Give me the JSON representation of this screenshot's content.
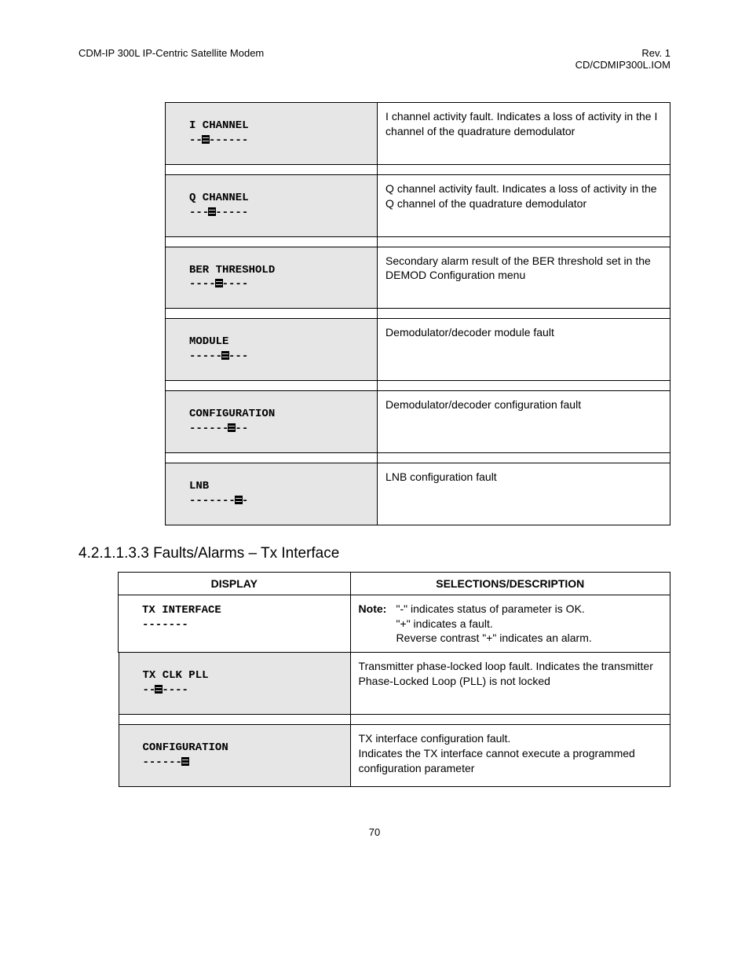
{
  "header": {
    "left": "CDM-IP 300L IP-Centric Satellite Modem",
    "right1": "Rev. 1",
    "right2": "CD/CDMIP300L.IOM"
  },
  "table1": {
    "rows": [
      {
        "label": "I CHANNEL",
        "pre": "--",
        "post": "------",
        "desc": "I channel activity fault. Indicates a loss of activity in the I channel of the quadrature demodulator"
      },
      {
        "label": "Q CHANNEL",
        "pre": "---",
        "post": "-----",
        "desc": "Q channel activity fault. Indicates a loss of activity in the Q channel of the quadrature demodulator"
      },
      {
        "label": "BER THRESHOLD",
        "pre": "----",
        "post": "----",
        "desc": "Secondary alarm result of the BER threshold set in the DEMOD Configuration menu"
      },
      {
        "label": "MODULE",
        "pre": "-----",
        "post": "---",
        "desc": "Demodulator/decoder module fault"
      },
      {
        "label": "CONFIGURATION",
        "pre": "------",
        "post": "--",
        "desc": "Demodulator/decoder configuration fault"
      },
      {
        "label": "LNB",
        "pre": "-------",
        "post": "-",
        "desc": "LNB configuration fault"
      }
    ]
  },
  "section": {
    "number": "4.2.1.1.3.3",
    "title": "Faults/Alarms – Tx Interface"
  },
  "table2": {
    "head_display": "DISPLAY",
    "head_desc": "SELECTIONS/DESCRIPTION",
    "intro": {
      "label": "TX INTERFACE",
      "dashes": "-------",
      "note_label": "Note:",
      "note_line1": "\"-\" indicates status of parameter is OK.",
      "note_line2": "\"+\" indicates a fault.",
      "note_line3": "Reverse contrast \"+\" indicates an alarm."
    },
    "rows": [
      {
        "label": "TX CLK PLL",
        "pre": "--",
        "post": "----",
        "desc": "Transmitter phase-locked loop fault. Indicates the transmitter Phase-Locked Loop (PLL) is not locked"
      },
      {
        "label": "CONFIGURATION",
        "pre": "------",
        "post": "",
        "desc_line1": "TX interface configuration fault.",
        "desc_line2": "Indicates the TX interface cannot execute a programmed configuration parameter"
      }
    ]
  },
  "page_number": "70"
}
